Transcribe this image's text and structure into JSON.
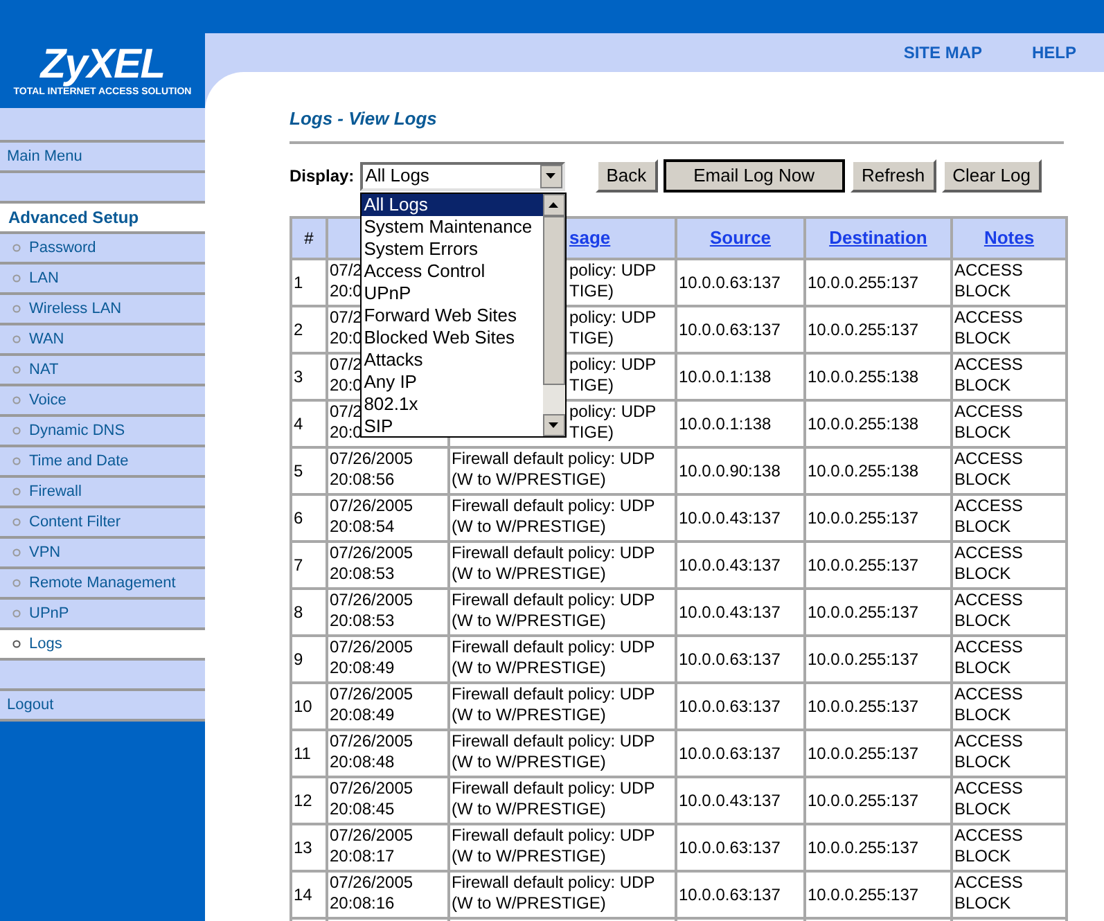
{
  "header": {
    "logo": "ZyXEL",
    "tagline": "TOTAL INTERNET ACCESS SOLUTION",
    "links": [
      "SITE MAP",
      "HELP"
    ]
  },
  "sidebar": {
    "items": [
      {
        "kind": "link",
        "label": "Main Menu",
        "selected": false
      },
      {
        "kind": "blank"
      },
      {
        "kind": "section",
        "label": "Advanced Setup"
      },
      {
        "kind": "sub",
        "label": "Password",
        "selected": false
      },
      {
        "kind": "sub",
        "label": "LAN",
        "selected": false
      },
      {
        "kind": "sub",
        "label": "Wireless LAN",
        "selected": false
      },
      {
        "kind": "sub",
        "label": "WAN",
        "selected": false
      },
      {
        "kind": "sub",
        "label": "NAT",
        "selected": false
      },
      {
        "kind": "sub",
        "label": "Voice",
        "selected": false
      },
      {
        "kind": "sub",
        "label": "Dynamic DNS",
        "selected": false
      },
      {
        "kind": "sub",
        "label": "Time and Date",
        "selected": false
      },
      {
        "kind": "sub",
        "label": "Firewall",
        "selected": false
      },
      {
        "kind": "sub",
        "label": "Content Filter",
        "selected": false
      },
      {
        "kind": "sub",
        "label": "VPN",
        "selected": false
      },
      {
        "kind": "sub",
        "label": "Remote Management",
        "selected": false
      },
      {
        "kind": "sub",
        "label": "UPnP",
        "selected": false
      },
      {
        "kind": "sub",
        "label": "Logs",
        "selected": true
      },
      {
        "kind": "blank"
      },
      {
        "kind": "link",
        "label": "Logout",
        "selected": false
      }
    ]
  },
  "title": "Logs - View Logs",
  "display": {
    "label": "Display:",
    "value": "All Logs",
    "options": [
      {
        "label": "All Logs",
        "selected": true
      },
      {
        "label": "System Maintenance",
        "selected": false
      },
      {
        "label": "System Errors",
        "selected": false
      },
      {
        "label": "Access Control",
        "selected": false
      },
      {
        "label": "UPnP",
        "selected": false
      },
      {
        "label": "Forward Web Sites",
        "selected": false
      },
      {
        "label": "Blocked Web Sites",
        "selected": false
      },
      {
        "label": "Attacks",
        "selected": false
      },
      {
        "label": "Any IP",
        "selected": false
      },
      {
        "label": "802.1x",
        "selected": false
      },
      {
        "label": "SIP",
        "selected": false
      }
    ]
  },
  "buttons": [
    {
      "label": "Back",
      "default": false
    },
    {
      "label": "Email Log Now",
      "default": true
    },
    {
      "label": "Refresh",
      "default": false
    },
    {
      "label": "Clear Log",
      "default": false
    }
  ],
  "table": {
    "columns": [
      {
        "label": "#",
        "kind": "plain"
      },
      {
        "kind": "hidden"
      },
      {
        "label": "sage",
        "kind": "partial"
      },
      {
        "label": "Source",
        "kind": "link"
      },
      {
        "label": "Destination",
        "kind": "link"
      },
      {
        "label": "Notes",
        "kind": "link"
      }
    ],
    "rows": [
      {
        "n": "1",
        "kind": "partial",
        "time": [
          "07/2",
          "20:0"
        ],
        "message": [
          "policy: UDP",
          "TIGE)"
        ],
        "source": "10.0.0.63:137",
        "destination": "10.0.0.255:137",
        "notes": [
          "ACCESS",
          "BLOCK"
        ]
      },
      {
        "n": "2",
        "kind": "partial",
        "time": [
          "07/2",
          "20:0"
        ],
        "message": [
          "policy: UDP",
          "TIGE)"
        ],
        "source": "10.0.0.63:137",
        "destination": "10.0.0.255:137",
        "notes": [
          "ACCESS",
          "BLOCK"
        ]
      },
      {
        "n": "3",
        "kind": "partial",
        "time": [
          "07/2",
          "20:0"
        ],
        "message": [
          "policy: UDP",
          "TIGE)"
        ],
        "source": "10.0.0.1:138",
        "destination": "10.0.0.255:138",
        "notes": [
          "ACCESS",
          "BLOCK"
        ]
      },
      {
        "n": "4",
        "kind": "partial",
        "time": [
          "07/2",
          "20:0"
        ],
        "message": [
          "policy: UDP",
          "TIGE)"
        ],
        "source": "10.0.0.1:138",
        "destination": "10.0.0.255:138",
        "notes": [
          "ACCESS",
          "BLOCK"
        ]
      },
      {
        "n": "5",
        "time": [
          "07/26/2005",
          "20:08:56"
        ],
        "message": [
          "Firewall default policy: UDP",
          "(W to W/PRESTIGE)"
        ],
        "source": "10.0.0.90:138",
        "destination": "10.0.0.255:138",
        "notes": [
          "ACCESS",
          "BLOCK"
        ]
      },
      {
        "n": "6",
        "time": [
          "07/26/2005",
          "20:08:54"
        ],
        "message": [
          "Firewall default policy: UDP",
          "(W to W/PRESTIGE)"
        ],
        "source": "10.0.0.43:137",
        "destination": "10.0.0.255:137",
        "notes": [
          "ACCESS",
          "BLOCK"
        ]
      },
      {
        "n": "7",
        "time": [
          "07/26/2005",
          "20:08:53"
        ],
        "message": [
          "Firewall default policy: UDP",
          "(W to W/PRESTIGE)"
        ],
        "source": "10.0.0.43:137",
        "destination": "10.0.0.255:137",
        "notes": [
          "ACCESS",
          "BLOCK"
        ]
      },
      {
        "n": "8",
        "time": [
          "07/26/2005",
          "20:08:53"
        ],
        "message": [
          "Firewall default policy: UDP",
          "(W to W/PRESTIGE)"
        ],
        "source": "10.0.0.43:137",
        "destination": "10.0.0.255:137",
        "notes": [
          "ACCESS",
          "BLOCK"
        ]
      },
      {
        "n": "9",
        "time": [
          "07/26/2005",
          "20:08:49"
        ],
        "message": [
          "Firewall default policy: UDP",
          "(W to W/PRESTIGE)"
        ],
        "source": "10.0.0.63:137",
        "destination": "10.0.0.255:137",
        "notes": [
          "ACCESS",
          "BLOCK"
        ]
      },
      {
        "n": "10",
        "time": [
          "07/26/2005",
          "20:08:49"
        ],
        "message": [
          "Firewall default policy: UDP",
          "(W to W/PRESTIGE)"
        ],
        "source": "10.0.0.63:137",
        "destination": "10.0.0.255:137",
        "notes": [
          "ACCESS",
          "BLOCK"
        ]
      },
      {
        "n": "11",
        "time": [
          "07/26/2005",
          "20:08:48"
        ],
        "message": [
          "Firewall default policy: UDP",
          "(W to W/PRESTIGE)"
        ],
        "source": "10.0.0.63:137",
        "destination": "10.0.0.255:137",
        "notes": [
          "ACCESS",
          "BLOCK"
        ]
      },
      {
        "n": "12",
        "time": [
          "07/26/2005",
          "20:08:45"
        ],
        "message": [
          "Firewall default policy: UDP",
          "(W to W/PRESTIGE)"
        ],
        "source": "10.0.0.43:137",
        "destination": "10.0.0.255:137",
        "notes": [
          "ACCESS",
          "BLOCK"
        ]
      },
      {
        "n": "13",
        "time": [
          "07/26/2005",
          "20:08:17"
        ],
        "message": [
          "Firewall default policy: UDP",
          "(W to W/PRESTIGE)"
        ],
        "source": "10.0.0.63:137",
        "destination": "10.0.0.255:137",
        "notes": [
          "ACCESS",
          "BLOCK"
        ]
      },
      {
        "n": "14",
        "time": [
          "07/26/2005",
          "20:08:16"
        ],
        "message": [
          "Firewall default policy: UDP",
          "(W to W/PRESTIGE)"
        ],
        "source": "10.0.0.63:137",
        "destination": "10.0.0.255:137",
        "notes": [
          "ACCESS",
          "BLOCK"
        ]
      }
    ]
  }
}
